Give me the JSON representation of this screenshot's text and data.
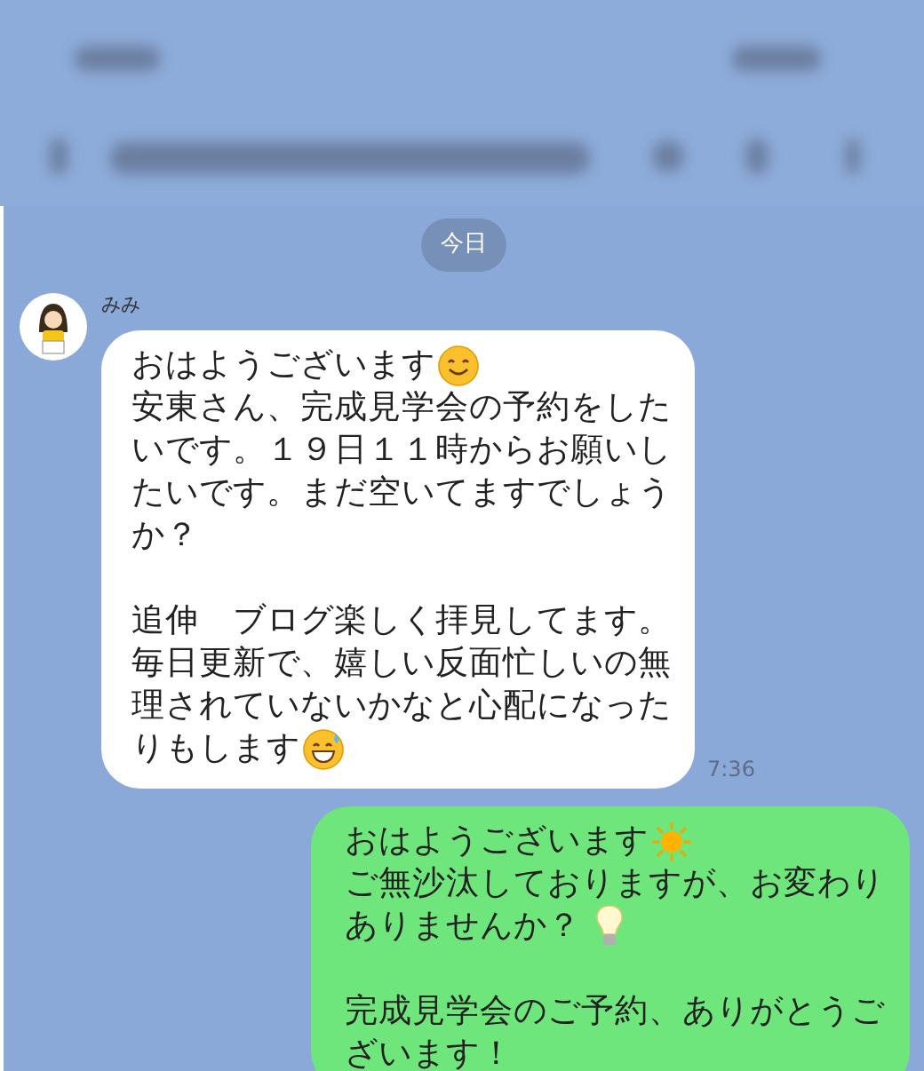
{
  "date_separator": {
    "label": "今日"
  },
  "messages": [
    {
      "kind": "incoming",
      "sender": "みみ",
      "time": "7:36",
      "paragraphs": [
        [
          "おはようございます",
          "安東さん、完成見学会の予約をした",
          "いです。１９日１１時からお願いし",
          "たいです。まだ空いてますでしょう",
          "か？"
        ],
        [
          "追伸　ブログ楽しく拝見してます。",
          "毎日更新で、嬉しい反面忙しいの無",
          "理されていないかなと心配になった",
          "りもします"
        ]
      ]
    },
    {
      "kind": "outgoing",
      "paragraphs": [
        [
          "おはようございます",
          "ご無沙汰しておりますが、お変わり",
          "ありませんか？"
        ],
        [
          "完成見学会のご予約、ありがとうご",
          "ざいます！"
        ]
      ]
    }
  ]
}
